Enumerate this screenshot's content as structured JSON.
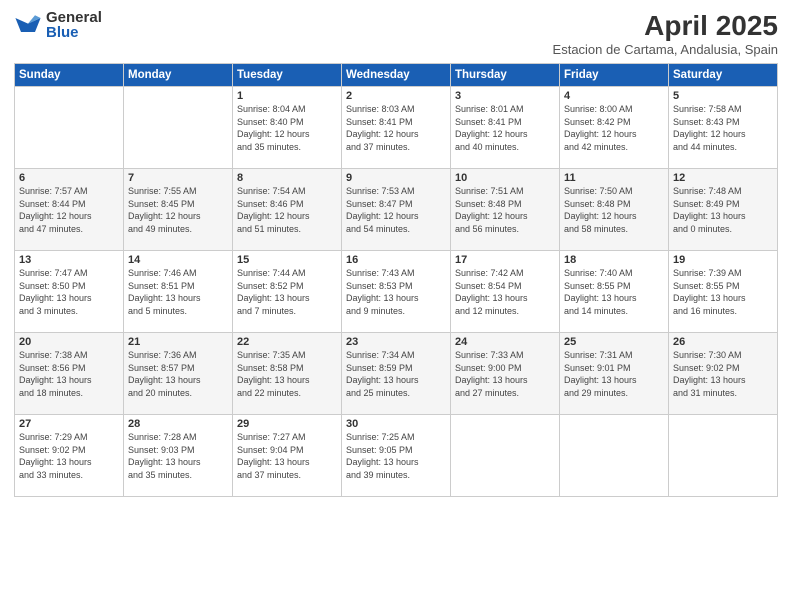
{
  "logo": {
    "general": "General",
    "blue": "Blue"
  },
  "header": {
    "title": "April 2025",
    "subtitle": "Estacion de Cartama, Andalusia, Spain"
  },
  "weekdays": [
    "Sunday",
    "Monday",
    "Tuesday",
    "Wednesday",
    "Thursday",
    "Friday",
    "Saturday"
  ],
  "weeks": [
    [
      {
        "day": "",
        "info": ""
      },
      {
        "day": "",
        "info": ""
      },
      {
        "day": "1",
        "info": "Sunrise: 8:04 AM\nSunset: 8:40 PM\nDaylight: 12 hours\nand 35 minutes."
      },
      {
        "day": "2",
        "info": "Sunrise: 8:03 AM\nSunset: 8:41 PM\nDaylight: 12 hours\nand 37 minutes."
      },
      {
        "day": "3",
        "info": "Sunrise: 8:01 AM\nSunset: 8:41 PM\nDaylight: 12 hours\nand 40 minutes."
      },
      {
        "day": "4",
        "info": "Sunrise: 8:00 AM\nSunset: 8:42 PM\nDaylight: 12 hours\nand 42 minutes."
      },
      {
        "day": "5",
        "info": "Sunrise: 7:58 AM\nSunset: 8:43 PM\nDaylight: 12 hours\nand 44 minutes."
      }
    ],
    [
      {
        "day": "6",
        "info": "Sunrise: 7:57 AM\nSunset: 8:44 PM\nDaylight: 12 hours\nand 47 minutes."
      },
      {
        "day": "7",
        "info": "Sunrise: 7:55 AM\nSunset: 8:45 PM\nDaylight: 12 hours\nand 49 minutes."
      },
      {
        "day": "8",
        "info": "Sunrise: 7:54 AM\nSunset: 8:46 PM\nDaylight: 12 hours\nand 51 minutes."
      },
      {
        "day": "9",
        "info": "Sunrise: 7:53 AM\nSunset: 8:47 PM\nDaylight: 12 hours\nand 54 minutes."
      },
      {
        "day": "10",
        "info": "Sunrise: 7:51 AM\nSunset: 8:48 PM\nDaylight: 12 hours\nand 56 minutes."
      },
      {
        "day": "11",
        "info": "Sunrise: 7:50 AM\nSunset: 8:48 PM\nDaylight: 12 hours\nand 58 minutes."
      },
      {
        "day": "12",
        "info": "Sunrise: 7:48 AM\nSunset: 8:49 PM\nDaylight: 13 hours\nand 0 minutes."
      }
    ],
    [
      {
        "day": "13",
        "info": "Sunrise: 7:47 AM\nSunset: 8:50 PM\nDaylight: 13 hours\nand 3 minutes."
      },
      {
        "day": "14",
        "info": "Sunrise: 7:46 AM\nSunset: 8:51 PM\nDaylight: 13 hours\nand 5 minutes."
      },
      {
        "day": "15",
        "info": "Sunrise: 7:44 AM\nSunset: 8:52 PM\nDaylight: 13 hours\nand 7 minutes."
      },
      {
        "day": "16",
        "info": "Sunrise: 7:43 AM\nSunset: 8:53 PM\nDaylight: 13 hours\nand 9 minutes."
      },
      {
        "day": "17",
        "info": "Sunrise: 7:42 AM\nSunset: 8:54 PM\nDaylight: 13 hours\nand 12 minutes."
      },
      {
        "day": "18",
        "info": "Sunrise: 7:40 AM\nSunset: 8:55 PM\nDaylight: 13 hours\nand 14 minutes."
      },
      {
        "day": "19",
        "info": "Sunrise: 7:39 AM\nSunset: 8:55 PM\nDaylight: 13 hours\nand 16 minutes."
      }
    ],
    [
      {
        "day": "20",
        "info": "Sunrise: 7:38 AM\nSunset: 8:56 PM\nDaylight: 13 hours\nand 18 minutes."
      },
      {
        "day": "21",
        "info": "Sunrise: 7:36 AM\nSunset: 8:57 PM\nDaylight: 13 hours\nand 20 minutes."
      },
      {
        "day": "22",
        "info": "Sunrise: 7:35 AM\nSunset: 8:58 PM\nDaylight: 13 hours\nand 22 minutes."
      },
      {
        "day": "23",
        "info": "Sunrise: 7:34 AM\nSunset: 8:59 PM\nDaylight: 13 hours\nand 25 minutes."
      },
      {
        "day": "24",
        "info": "Sunrise: 7:33 AM\nSunset: 9:00 PM\nDaylight: 13 hours\nand 27 minutes."
      },
      {
        "day": "25",
        "info": "Sunrise: 7:31 AM\nSunset: 9:01 PM\nDaylight: 13 hours\nand 29 minutes."
      },
      {
        "day": "26",
        "info": "Sunrise: 7:30 AM\nSunset: 9:02 PM\nDaylight: 13 hours\nand 31 minutes."
      }
    ],
    [
      {
        "day": "27",
        "info": "Sunrise: 7:29 AM\nSunset: 9:02 PM\nDaylight: 13 hours\nand 33 minutes."
      },
      {
        "day": "28",
        "info": "Sunrise: 7:28 AM\nSunset: 9:03 PM\nDaylight: 13 hours\nand 35 minutes."
      },
      {
        "day": "29",
        "info": "Sunrise: 7:27 AM\nSunset: 9:04 PM\nDaylight: 13 hours\nand 37 minutes."
      },
      {
        "day": "30",
        "info": "Sunrise: 7:25 AM\nSunset: 9:05 PM\nDaylight: 13 hours\nand 39 minutes."
      },
      {
        "day": "",
        "info": ""
      },
      {
        "day": "",
        "info": ""
      },
      {
        "day": "",
        "info": ""
      }
    ]
  ]
}
